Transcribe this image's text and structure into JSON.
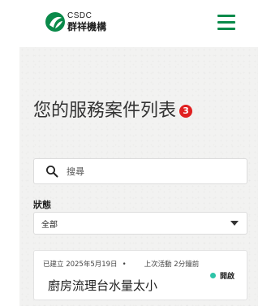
{
  "header": {
    "logo_en": "CSDC",
    "logo_zh": "群祥機構",
    "brand_color": "#0a8a4a",
    "menu_icon": "hamburger-menu-icon"
  },
  "page": {
    "title": "您的服務案件列表",
    "count_badge": "3",
    "badge_color": "#e02020"
  },
  "search": {
    "placeholder": "搜尋",
    "icon": "search-icon"
  },
  "filter": {
    "label": "狀態",
    "selected": "全部"
  },
  "cases": [
    {
      "created": "已建立 2025年5月19日",
      "separator": "•",
      "last_activity": "上次活動 2分鐘前",
      "title": "廚房流理台水量太小",
      "status": "開啟",
      "status_color": "#2ec4a8"
    }
  ]
}
